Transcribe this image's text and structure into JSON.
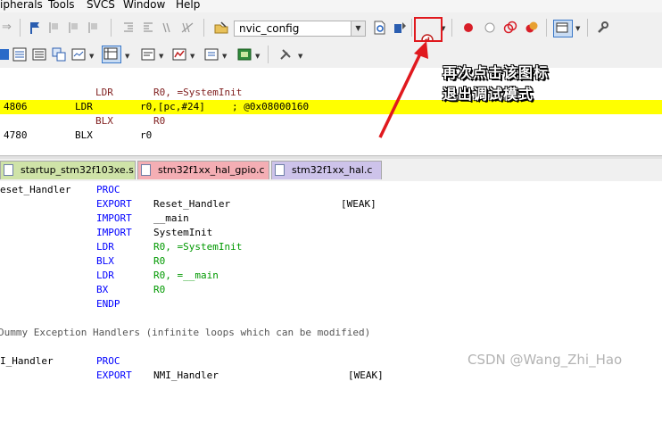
{
  "menu": {
    "items": [
      "ipherals",
      "Tools",
      "SVCS",
      "Window",
      "Help"
    ]
  },
  "toolbar": {
    "target_value": "nvic_config"
  },
  "annotation": {
    "line1": "再次点击该图标",
    "line2": "退出调试模式"
  },
  "disassembly": [
    {
      "addr": "",
      "op": "LDR",
      "args": "R0, =SystemInit",
      "comment": "",
      "highlight": false
    },
    {
      "addr": "4806",
      "op": "LDR",
      "args": "r0,[pc,#24]",
      "comment": "; @0x08000160",
      "highlight": true
    },
    {
      "addr": "",
      "op": "BLX",
      "args": "R0",
      "comment": "",
      "highlight": false
    },
    {
      "addr": "4780",
      "op": "BLX",
      "args": "r0",
      "comment": "",
      "highlight": false
    }
  ],
  "tabs": [
    {
      "label": "startup_stm32f103xe.s",
      "active": true,
      "color": "#cfe3a8"
    },
    {
      "label": "stm32f1xx_hal_gpio.c",
      "active": false,
      "color": "#f4aeb4"
    },
    {
      "label": "stm32f1xx_hal.c",
      "active": false,
      "color": "#cdc3ea"
    }
  ],
  "code": {
    "l1_label": "eset_Handler",
    "l1_kw": "PROC",
    "l2_kw": "EXPORT",
    "l2_arg": "Reset_Handler",
    "l2_extra": "[WEAK]",
    "l3_kw": "IMPORT",
    "l3_arg": "__main",
    "l4_kw": "IMPORT",
    "l4_arg": "SystemInit",
    "l5_kw": "LDR",
    "l5_arg": "R0, =SystemInit",
    "l6_kw": "BLX",
    "l6_arg": "R0",
    "l7_kw": "LDR",
    "l7_arg": "R0, =__main",
    "l8_kw": "BX",
    "l8_arg": "R0",
    "l9_kw": "ENDP",
    "comment": "Dummy Exception Handlers (infinite loops which can be modified)",
    "l11_label": "I_Handler",
    "l11_kw": "PROC",
    "l12_kw": "EXPORT",
    "l12_arg": "NMI_Handler",
    "l12_extra": "[WEAK]"
  },
  "watermark": "CSDN @Wang_Zhi_Hao",
  "colors": {
    "highlight": "#ffff00",
    "keyword": "#0000ff",
    "annotation_red": "#e0191e"
  }
}
